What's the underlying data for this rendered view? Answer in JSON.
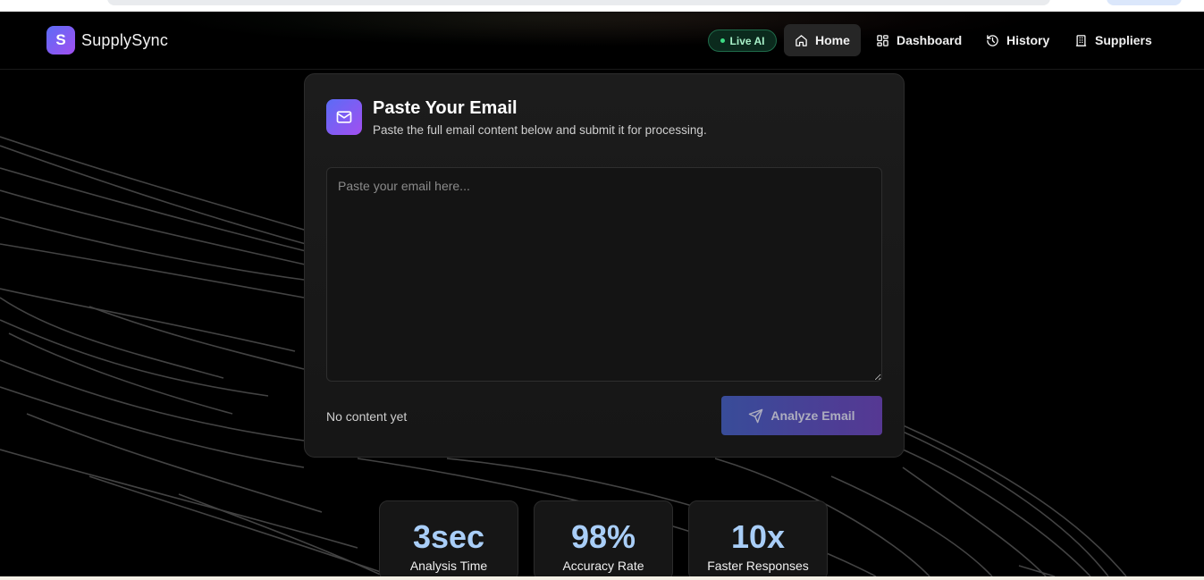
{
  "brand": {
    "logo_letter": "S",
    "name": "SupplySync"
  },
  "nav": {
    "live_badge": "Live AI",
    "items": [
      {
        "label": "Home",
        "icon": "home-icon",
        "active": true
      },
      {
        "label": "Dashboard",
        "icon": "dashboard-icon",
        "active": false
      },
      {
        "label": "History",
        "icon": "history-icon",
        "active": false
      },
      {
        "label": "Suppliers",
        "icon": "building-icon",
        "active": false
      }
    ]
  },
  "card": {
    "icon": "mail-icon",
    "title": "Paste Your Email",
    "subtitle": "Paste the full email content below and submit it for processing.",
    "textarea_placeholder": "Paste your email here...",
    "textarea_value": "",
    "status": "No content yet",
    "submit_label": "Analyze Email",
    "submit_icon": "send-icon"
  },
  "stats": [
    {
      "value": "3sec",
      "label": "Analysis Time"
    },
    {
      "value": "98%",
      "label": "Accuracy Rate"
    },
    {
      "value": "10x",
      "label": "Faster Responses"
    }
  ],
  "colors": {
    "accent_start": "#5b6cf6",
    "accent_end": "#a24ff0",
    "stat_value": "#a9cef8",
    "live_dot": "#3ddc84"
  }
}
